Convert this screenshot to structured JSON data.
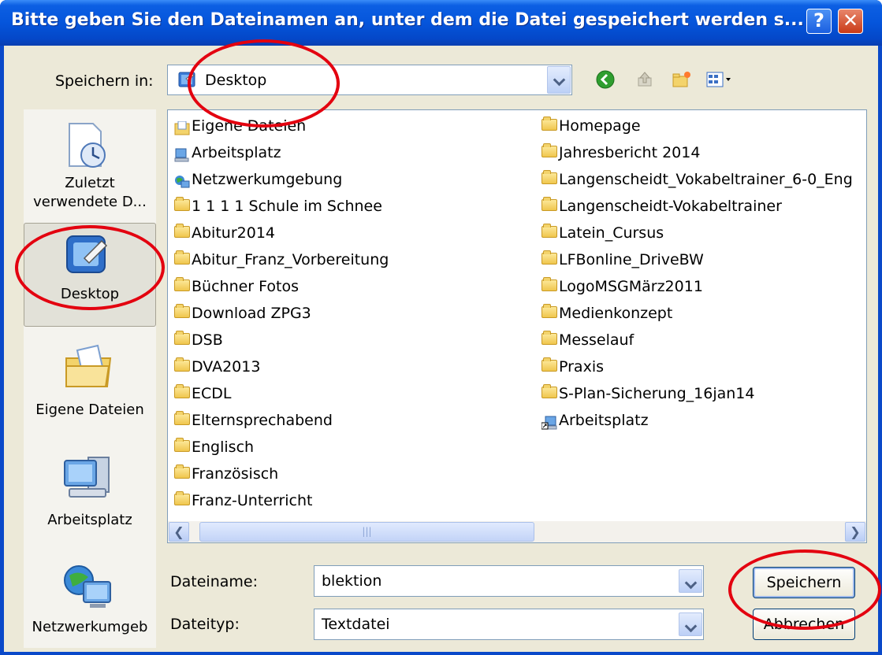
{
  "window": {
    "title": "Bitte geben Sie den Dateinamen an, unter dem die Datei gespeichert werden s...",
    "help_label": "?",
    "close_label": "✕"
  },
  "toolbar": {
    "save_in_label": "Speichern in:",
    "location_value": "Desktop"
  },
  "places": [
    {
      "label": "Zuletzt verwendete D...",
      "icon": "recent-documents-icon"
    },
    {
      "label": "Desktop",
      "icon": "desktop-icon",
      "selected": true
    },
    {
      "label": "Eigene Dateien",
      "icon": "my-documents-icon"
    },
    {
      "label": "Arbeitsplatz",
      "icon": "my-computer-icon"
    },
    {
      "label": "Netzwerkumgeb",
      "icon": "network-places-icon"
    }
  ],
  "files_col1": [
    {
      "name": "Eigene Dateien",
      "icon": "my-documents-icon"
    },
    {
      "name": "Arbeitsplatz",
      "icon": "my-computer-icon"
    },
    {
      "name": "Netzwerkumgebung",
      "icon": "network-icon"
    },
    {
      "name": "1 1 1 1 Schule im Schnee",
      "icon": "folder-icon"
    },
    {
      "name": "Abitur2014",
      "icon": "folder-icon"
    },
    {
      "name": "Abitur_Franz_Vorbereitung",
      "icon": "folder-icon"
    },
    {
      "name": "Büchner Fotos",
      "icon": "folder-icon"
    },
    {
      "name": "Download ZPG3",
      "icon": "folder-icon"
    },
    {
      "name": "DSB",
      "icon": "folder-icon"
    },
    {
      "name": "DVA2013",
      "icon": "folder-icon"
    },
    {
      "name": "ECDL",
      "icon": "folder-icon"
    },
    {
      "name": "Elternsprechabend",
      "icon": "folder-icon"
    },
    {
      "name": "Englisch",
      "icon": "folder-icon"
    },
    {
      "name": "Französisch",
      "icon": "folder-icon"
    },
    {
      "name": "Franz-Unterricht",
      "icon": "folder-icon"
    }
  ],
  "files_col2": [
    {
      "name": "Homepage",
      "icon": "folder-icon"
    },
    {
      "name": "Jahresbericht 2014",
      "icon": "folder-icon"
    },
    {
      "name": "Langenscheidt_Vokabeltrainer_6-0_Eng",
      "icon": "folder-icon"
    },
    {
      "name": "Langenscheidt-Vokabeltrainer",
      "icon": "folder-icon"
    },
    {
      "name": "Latein_Cursus",
      "icon": "folder-icon"
    },
    {
      "name": "LFBonline_DriveBW",
      "icon": "folder-icon"
    },
    {
      "name": "LogoMSGMärz2011",
      "icon": "folder-icon"
    },
    {
      "name": "Medienkonzept",
      "icon": "folder-icon"
    },
    {
      "name": "Messelauf",
      "icon": "folder-icon"
    },
    {
      "name": "Praxis",
      "icon": "folder-icon"
    },
    {
      "name": "S-Plan-Sicherung_16jan14",
      "icon": "folder-icon"
    },
    {
      "name": "Arbeitsplatz",
      "icon": "my-computer-shortcut-icon"
    }
  ],
  "form": {
    "filename_label": "Dateiname:",
    "filename_value": "blektion",
    "filetype_label": "Dateityp:",
    "filetype_value": "Textdatei",
    "save_button": "Speichern",
    "cancel_button": "Abbrechen"
  },
  "colors": {
    "annotation": "#e3000f",
    "titlebar": "#0555db",
    "dialog_bg": "#ece9d8"
  }
}
